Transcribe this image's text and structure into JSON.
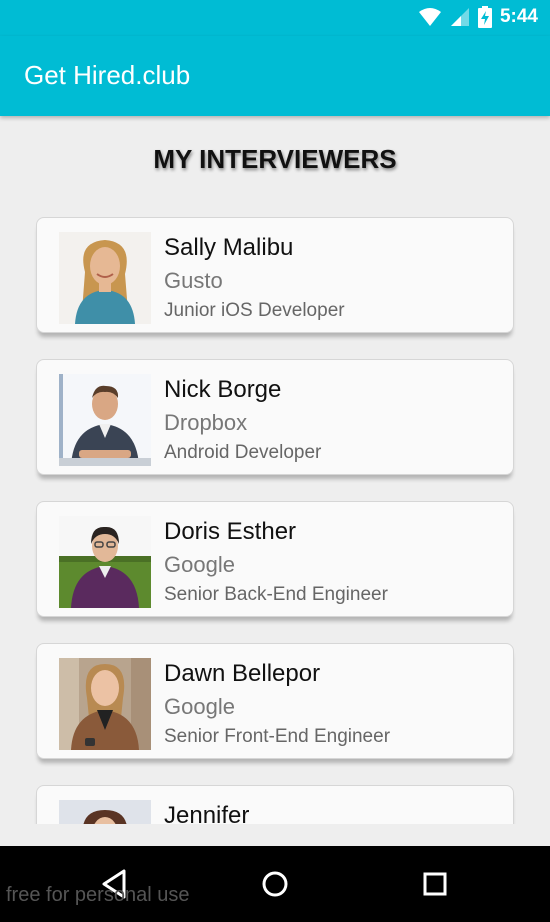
{
  "status_bar": {
    "time": "5:44",
    "icons": [
      "wifi-icon",
      "cell-signal-icon",
      "battery-charging-icon"
    ]
  },
  "app_bar": {
    "title": "Get Hired.club",
    "color": "#00bcd4"
  },
  "section_title": "MY INTERVIEWERS",
  "interviewers": [
    {
      "name": "Sally Malibu",
      "company": "Gusto",
      "role": "Junior iOS Developer"
    },
    {
      "name": "Nick Borge",
      "company": "Dropbox",
      "role": "Android Developer"
    },
    {
      "name": "Doris Esther",
      "company": "Google",
      "role": "Senior Back-End Engineer"
    },
    {
      "name": "Dawn Bellepor",
      "company": "Google",
      "role": "Senior Front-End Engineer"
    },
    {
      "name": "Jennifer",
      "company": "",
      "role": ""
    }
  ],
  "nav_bar": {
    "icons": [
      "back-icon",
      "home-icon",
      "recents-icon"
    ]
  },
  "watermark": "free for personal use"
}
